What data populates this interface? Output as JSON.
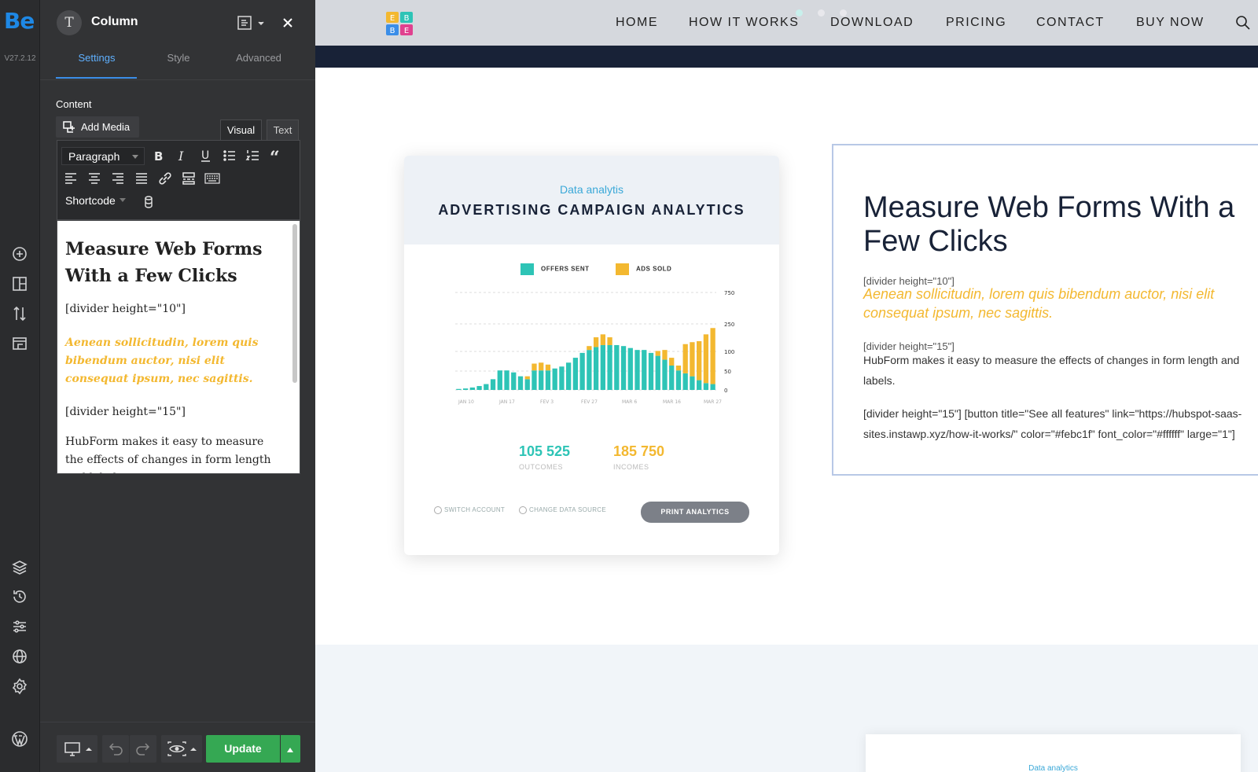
{
  "builder": {
    "logo": "Be",
    "version": "V27.2.12"
  },
  "panel": {
    "icon_letter": "T",
    "title": "Column",
    "tabs": [
      "Settings",
      "Style",
      "Advanced"
    ],
    "active_tab": "Settings",
    "content_label": "Content",
    "add_media": "Add Media",
    "editor_tabs": [
      "Visual",
      "Text"
    ],
    "format_select": "Paragraph",
    "shortcode": "Shortcode",
    "editor": {
      "heading": "Measure Web Forms With a Few Clicks",
      "divider1": "[divider height=\"10\"]",
      "gold_text": "Aenean sollicitudin, lorem quis bibendum auctor, nisi elit consequat ipsum, nec sagittis.",
      "divider2": "[divider height=\"15\"]",
      "body": "HubForm makes it easy to measure the effects of changes in form length and labels."
    },
    "update": "Update"
  },
  "site": {
    "nav": [
      "HOME",
      "HOW IT WORKS",
      "DOWNLOAD",
      "PRICING",
      "CONTACT",
      "BUY NOW"
    ],
    "logo_letters": [
      "E",
      "B",
      "B",
      "E"
    ],
    "card": {
      "subtitle": "Data analytis",
      "title": "ADVERTISING CAMPAIGN ANALYTICS",
      "legend": [
        "OFFERS SENT",
        "ADS SOLD"
      ],
      "stat1_value": "105 525",
      "stat1_label": "OUTCOMES",
      "stat2_value": "185 750",
      "stat2_label": "INCOMES",
      "footer_left1": "SWITCH ACCOUNT",
      "footer_left2": "CHANGE DATA SOURCE",
      "print_button": "PRINT ANALYTICS"
    },
    "textbox": {
      "heading": "Measure Web Forms With a Few Clicks",
      "divider1": "[divider height=\"10\"]",
      "gold_text": "Aenean sollicitudin, lorem quis bibendum auctor, nisi elit consequat ipsum, nec sagittis.",
      "divider2": "[divider height=\"15\"]",
      "body": "HubForm makes it easy to measure the effects of changes in form length and labels.",
      "shortcode": "[divider height=\"15\"] [button title=\"See all features\" link=\"https://hubspot-saas-sites.instawp.xyz/how-it-works/\" color=\"#febc1f\" font_color=\"#ffffff\" large=\"1\"]"
    },
    "card2_subtitle": "Data analytics"
  },
  "colors": {
    "accent_blue": "#3b8ee8",
    "update_green": "#35a853",
    "gold": "#f3b830",
    "teal": "#2ec4b6",
    "navy": "#182237"
  },
  "chart_data": {
    "type": "bar",
    "categories": [
      "JAN 10",
      "JAN 17",
      "FEV 3",
      "FEV 27",
      "MAR 6",
      "MAR 16",
      "MAR 27"
    ],
    "y_ticks": [
      "750",
      "250",
      "100",
      "50",
      "0"
    ],
    "series": [
      {
        "name": "OFFERS SENT",
        "values": [
          2,
          3,
          5,
          8,
          12,
          22,
          40,
          40,
          36,
          28,
          22,
          40,
          40,
          40,
          44,
          48,
          56,
          66,
          76,
          82,
          88,
          92,
          92,
          92,
          90,
          86,
          82,
          82,
          76,
          70,
          62,
          50,
          40,
          34,
          28,
          20,
          14,
          12
        ]
      },
      {
        "name": "ADS SOLD",
        "values": [
          0,
          0,
          0,
          0,
          0,
          0,
          0,
          0,
          0,
          0,
          6,
          14,
          16,
          12,
          0,
          0,
          0,
          0,
          0,
          8,
          20,
          22,
          16,
          0,
          0,
          0,
          0,
          0,
          0,
          10,
          20,
          16,
          10,
          60,
          70,
          80,
          100,
          115
        ]
      }
    ]
  }
}
